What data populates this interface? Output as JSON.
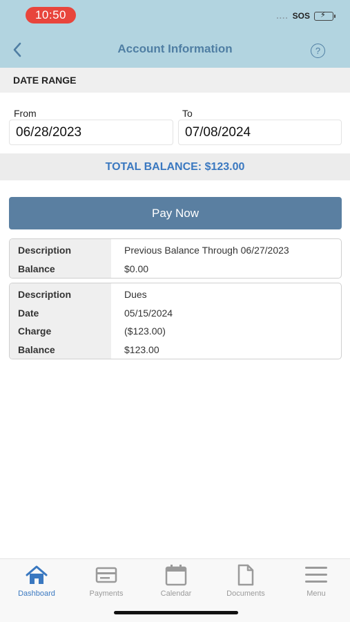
{
  "status_bar": {
    "time": "10:50",
    "signal": "....",
    "sos": "SOS"
  },
  "nav": {
    "title": "Account Information",
    "back_icon": "chevron-left-icon",
    "help_symbol": "?"
  },
  "date_range": {
    "heading": "DATE RANGE",
    "from_label": "From",
    "from_value": "06/28/2023",
    "to_label": "To",
    "to_value": "07/08/2024"
  },
  "total_balance": "TOTAL BALANCE: $123.00",
  "pay_button": "Pay Now",
  "transactions": [
    {
      "rows": [
        {
          "label": "Description",
          "value": "Previous Balance Through 06/27/2023"
        },
        {
          "label": "Balance",
          "value": "$0.00"
        }
      ]
    },
    {
      "rows": [
        {
          "label": "Description",
          "value": "Dues"
        },
        {
          "label": "Date",
          "value": "05/15/2024"
        },
        {
          "label": "Charge",
          "value": "($123.00)"
        },
        {
          "label": "Balance",
          "value": "$123.00"
        }
      ]
    }
  ],
  "tabs": [
    {
      "label": "Dashboard",
      "icon": "home-icon",
      "active": true
    },
    {
      "label": "Payments",
      "icon": "credit-card-icon",
      "active": false
    },
    {
      "label": "Calendar",
      "icon": "calendar-icon",
      "active": false
    },
    {
      "label": "Documents",
      "icon": "document-icon",
      "active": false
    },
    {
      "label": "Menu",
      "icon": "hamburger-menu-icon",
      "active": false
    }
  ],
  "colors": {
    "header_bg": "#b2d4e0",
    "accent": "#4f7ea3",
    "total_text": "#3a78c0",
    "pay_button_bg": "#5a7fa1",
    "time_pill": "#e8453c",
    "active_tab": "#3a78c0",
    "inactive_tab": "#9a9a9a"
  }
}
